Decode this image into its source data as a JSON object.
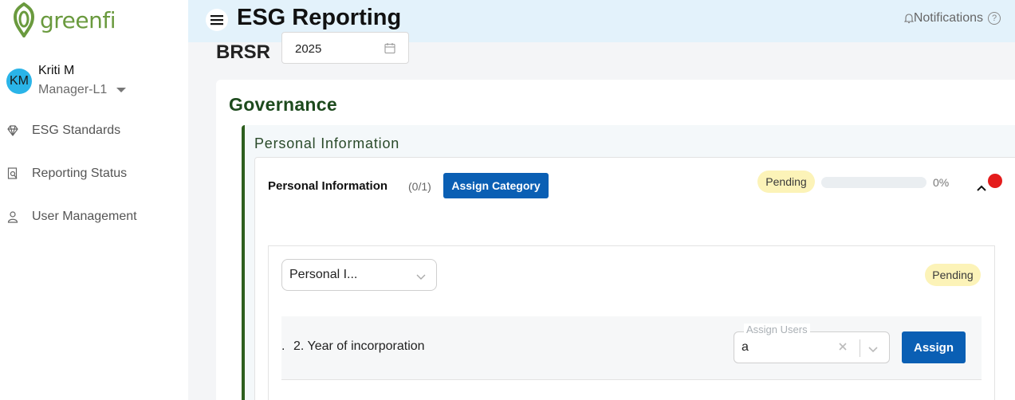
{
  "brand": {
    "name": "greenfi",
    "logo_color": "#6a9a3e"
  },
  "user": {
    "initials": "KM",
    "name": "Kriti M",
    "role": "Manager-L1"
  },
  "sidebar": {
    "items": [
      {
        "label": "ESG Standards",
        "icon": "diamond-icon"
      },
      {
        "label": "Reporting Status",
        "icon": "report-search-icon"
      },
      {
        "label": "User Management",
        "icon": "user-icon"
      }
    ]
  },
  "header": {
    "title": "ESG Reporting",
    "notifications_label": "Notifications",
    "help_glyph": "?",
    "background": "#e3f2fb"
  },
  "toolbar": {
    "framework": "BRSR",
    "year": "2025"
  },
  "governance": {
    "title": "Governance",
    "section_title": "Personal Information",
    "category": {
      "name": "Personal Information",
      "count": "(0/1)",
      "assign_category_label": "Assign Category",
      "status": "Pending",
      "progress_percent": 0,
      "progress_label": "0%"
    },
    "subsection": {
      "selected": "Personal I...",
      "status": "Pending",
      "question": {
        "prefix": ".",
        "text": "2. Year of incorporation",
        "assign_users_label": "Assign Users",
        "assign_users_value": "a",
        "assign_button_label": "Assign"
      }
    }
  },
  "colors": {
    "primary_button": "#0a5fb4",
    "pending_bg": "#fcf3b8",
    "governance_accent": "#2d5e1e",
    "alert_dot": "#e41c1c"
  }
}
